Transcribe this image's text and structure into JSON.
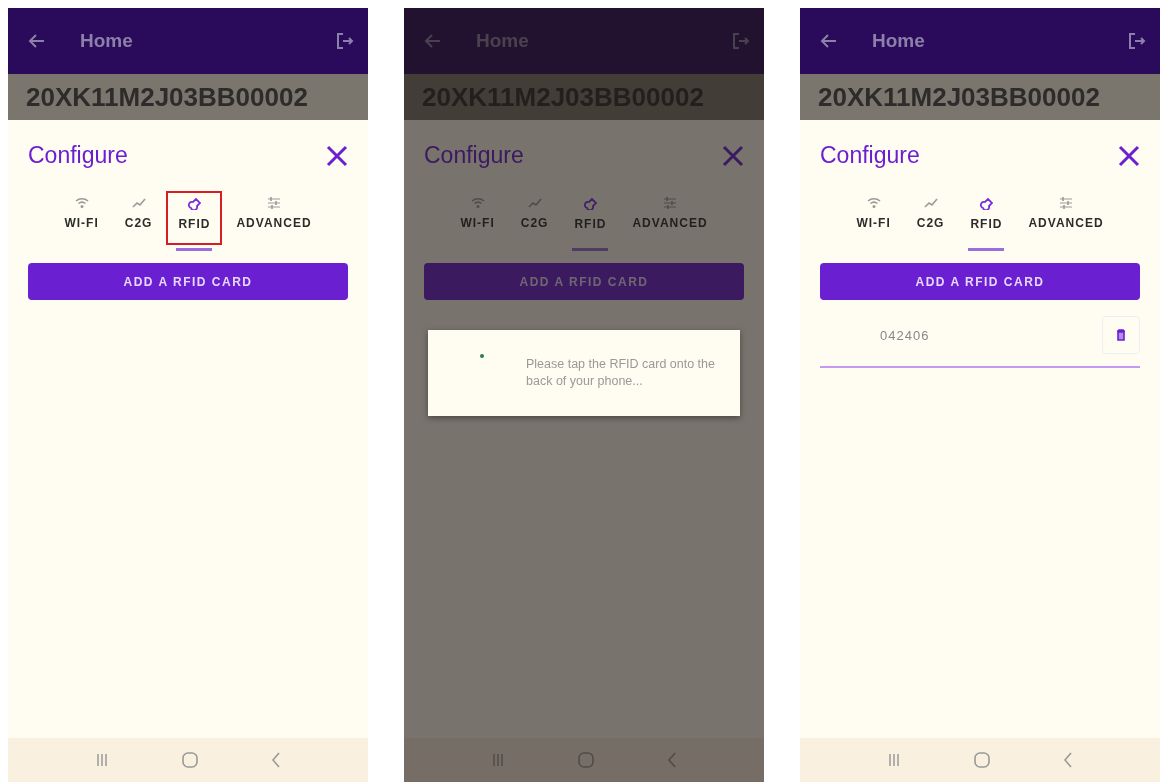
{
  "screens": [
    {
      "app_bar": {
        "title": "Home"
      },
      "serial": "20XK11M2J03BB00002",
      "sheet_title": "Configure",
      "dimmed": false,
      "add_button": "ADD A RFID CARD",
      "tabs": [
        {
          "kind": "wifi",
          "label": "WI-FI",
          "selected": false,
          "outlined": false
        },
        {
          "kind": "chart",
          "label": "C2G",
          "selected": false,
          "outlined": false
        },
        {
          "kind": "rfid",
          "label": "RFID",
          "selected": true,
          "outlined": true
        },
        {
          "kind": "sliders",
          "label": "ADVANCED",
          "selected": false,
          "outlined": false
        }
      ]
    },
    {
      "app_bar": {
        "title": "Home"
      },
      "serial": "20XK11M2J03BB00002",
      "sheet_title": "Configure",
      "dimmed": true,
      "add_button": "ADD A RFID CARD",
      "tabs": [
        {
          "kind": "wifi",
          "label": "WI-FI",
          "selected": false,
          "outlined": false
        },
        {
          "kind": "chart",
          "label": "C2G",
          "selected": false,
          "outlined": false
        },
        {
          "kind": "rfid",
          "label": "RFID",
          "selected": true,
          "outlined": false
        },
        {
          "kind": "sliders",
          "label": "ADVANCED",
          "selected": false,
          "outlined": false
        }
      ],
      "dialog": {
        "message": "Please tap the RFID card onto the back of your phone..."
      }
    },
    {
      "app_bar": {
        "title": "Home"
      },
      "serial": "20XK11M2J03BB00002",
      "sheet_title": "Configure",
      "dimmed": false,
      "add_button": "ADD A RFID CARD",
      "tabs": [
        {
          "kind": "wifi",
          "label": "WI-FI",
          "selected": false,
          "outlined": false
        },
        {
          "kind": "chart",
          "label": "C2G",
          "selected": false,
          "outlined": false
        },
        {
          "kind": "rfid",
          "label": "RFID",
          "selected": true,
          "outlined": false
        },
        {
          "kind": "sliders",
          "label": "ADVANCED",
          "selected": false,
          "outlined": false
        }
      ],
      "cards": [
        {
          "id": "042406"
        }
      ]
    }
  ]
}
